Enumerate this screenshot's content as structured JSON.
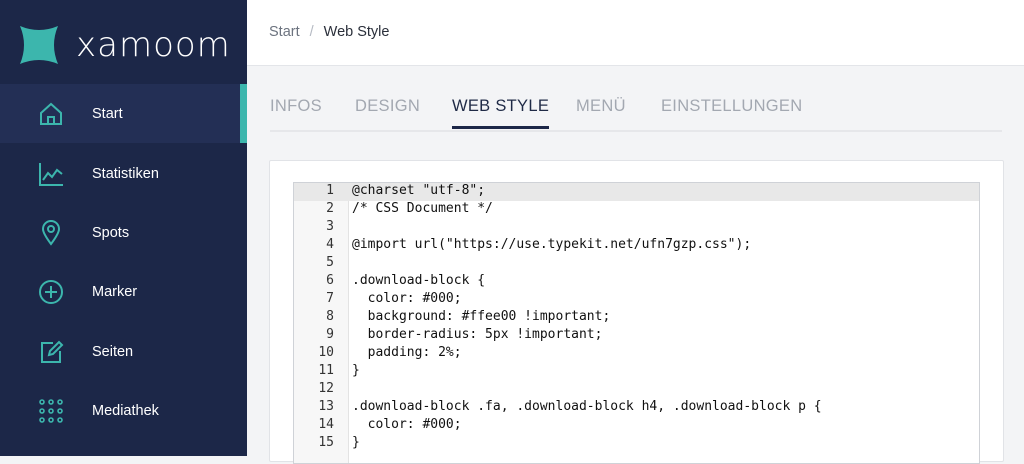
{
  "brand": {
    "name": "xamoom",
    "accent": "#3cb6ad",
    "sidebar_bg": "#1c2748"
  },
  "sidebar": {
    "items": [
      {
        "label": "Start",
        "icon": "home-icon",
        "active": true
      },
      {
        "label": "Statistiken",
        "icon": "chart-icon",
        "active": false
      },
      {
        "label": "Spots",
        "icon": "map-pin-icon",
        "active": false
      },
      {
        "label": "Marker",
        "icon": "plus-circle-icon",
        "active": false
      },
      {
        "label": "Seiten",
        "icon": "edit-page-icon",
        "active": false
      },
      {
        "label": "Mediathek",
        "icon": "grid-dots-icon",
        "active": false
      }
    ]
  },
  "breadcrumb": {
    "root": "Start",
    "separator": "/",
    "current": "Web Style"
  },
  "tabs": [
    {
      "label": "INFOS",
      "active": false
    },
    {
      "label": "DESIGN",
      "active": false
    },
    {
      "label": "WEB STYLE",
      "active": true
    },
    {
      "label": "MENÜ",
      "active": false
    },
    {
      "label": "EINSTELLUNGEN",
      "active": false
    }
  ],
  "editor": {
    "active_line": 1,
    "lines": [
      "@charset \"utf-8\";",
      "/* CSS Document */",
      "",
      "@import url(\"https://use.typekit.net/ufn7gzp.css\");",
      "",
      ".download-block {",
      "  color: #000;",
      "  background: #ffee00 !important;",
      "  border-radius: 5px !important;",
      "  padding: 2%;",
      "}",
      "",
      ".download-block .fa, .download-block h4, .download-block p {",
      "  color: #000;",
      "}"
    ]
  }
}
